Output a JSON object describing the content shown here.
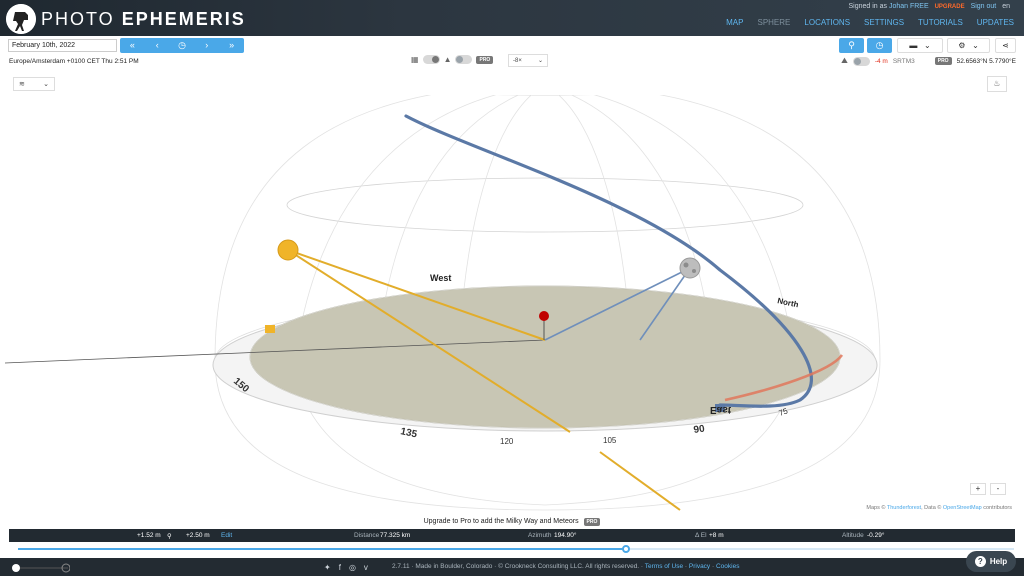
{
  "header": {
    "brand_thin": "PHOTO",
    "brand_bold": "EPHEMERIS",
    "signed_in_prefix": "Signed in as",
    "user": "Johan FREE",
    "upgrade": "UPGRADE",
    "sign_out": "Sign out",
    "lang": "en",
    "nav": [
      {
        "label": "MAP",
        "active": false
      },
      {
        "label": "SPHERE",
        "active": true
      },
      {
        "label": "LOCATIONS",
        "active": false
      },
      {
        "label": "SETTINGS",
        "active": false
      },
      {
        "label": "TUTORIALS",
        "active": false
      },
      {
        "label": "UPDATES",
        "active": false
      }
    ]
  },
  "toolbar": {
    "date_value": "February 10th, 2022",
    "step_buttons": [
      "«",
      "‹",
      "◷",
      "›",
      "»"
    ],
    "timezone": "Europe/Amsterdam +0100 CET Thu 2:51 PM",
    "pro_label": "PRO",
    "time_step": "-8×",
    "elevation": "-4 m",
    "dem": "SRTM3",
    "coords": "52.6563°N 5.7790°E"
  },
  "scene": {
    "labels": {
      "west": "West",
      "north": "North",
      "east": "East"
    },
    "ticks": [
      "150",
      "135",
      "120",
      "105",
      "90",
      "75"
    ],
    "colors": {
      "sun": "#f0b429",
      "moon_path": "#5b79a6",
      "ground": "#c8c6b4",
      "pin": "#c00000"
    }
  },
  "map_attribution": {
    "prefix": "Maps ©",
    "thunderforest": "Thunderforest",
    "data": ", Data ©",
    "osm": "OpenStreetMap",
    "suffix": "contributors"
  },
  "zoom": {
    "in": "+",
    "out": "-"
  },
  "upgrade_message": "Upgrade to Pro to add the Milky Way and Meteors",
  "status": {
    "height_obs": "+1.52 m",
    "height_target": "+2.50 m",
    "edit": "Edit",
    "distance_label": "Distance",
    "distance": "77.325 km",
    "azimuth_label": "Azimuth",
    "azimuth": "194.90°",
    "delta_el_label": "Δ El",
    "delta_el": "+8 m",
    "altitude_label": "Altitude",
    "altitude": "-0.29°"
  },
  "timeline": {
    "progress": 0.61
  },
  "footer": {
    "version": "2.7.11",
    "made": "Made in Boulder, Colorado",
    "copyright": "© Crookneck Consulting LLC. All rights reserved.",
    "terms": "Terms of Use",
    "privacy": "Privacy",
    "cookies": "Cookies",
    "help": "Help"
  }
}
